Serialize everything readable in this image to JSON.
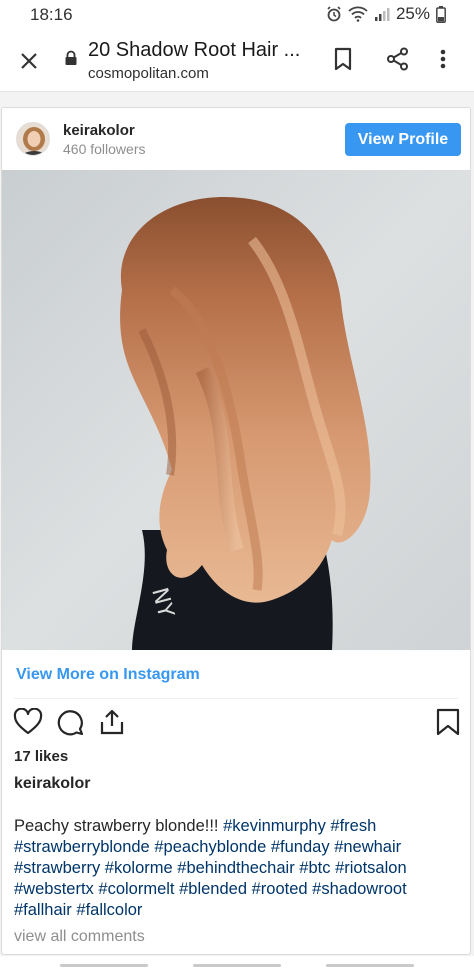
{
  "status": {
    "time": "18:16",
    "battery": "25%"
  },
  "browser": {
    "title": "20 Shadow Root Hair ...",
    "domain": "cosmopolitan.com",
    "icons": [
      "close-icon",
      "lock-icon",
      "bookmark-icon",
      "share-icon",
      "more-vert-icon"
    ]
  },
  "post": {
    "username": "keirakolor",
    "followers": "460 followers",
    "view_profile": "View Profile",
    "view_more": "View More on Instagram",
    "likes": "17 likes",
    "caption_user": "keirakolor",
    "caption_text": "Peachy strawberry blonde!!! ",
    "hashtags": [
      "#kevinmurphy",
      "#fresh",
      "#strawberryblonde",
      "#peachyblonde",
      "#funday",
      "#newhair",
      "#strawberry",
      "#kolorme",
      "#behindthechair",
      "#btc",
      "#riotsalon",
      "#webstertx",
      "#colormelt",
      "#blended",
      "#rooted",
      "#shadowroot",
      "#fallhair",
      "#fallcolor"
    ],
    "view_comments": "view all comments"
  },
  "colors": {
    "accent": "#3897f0",
    "hashtag": "#003569",
    "muted": "#8e8e8e"
  }
}
